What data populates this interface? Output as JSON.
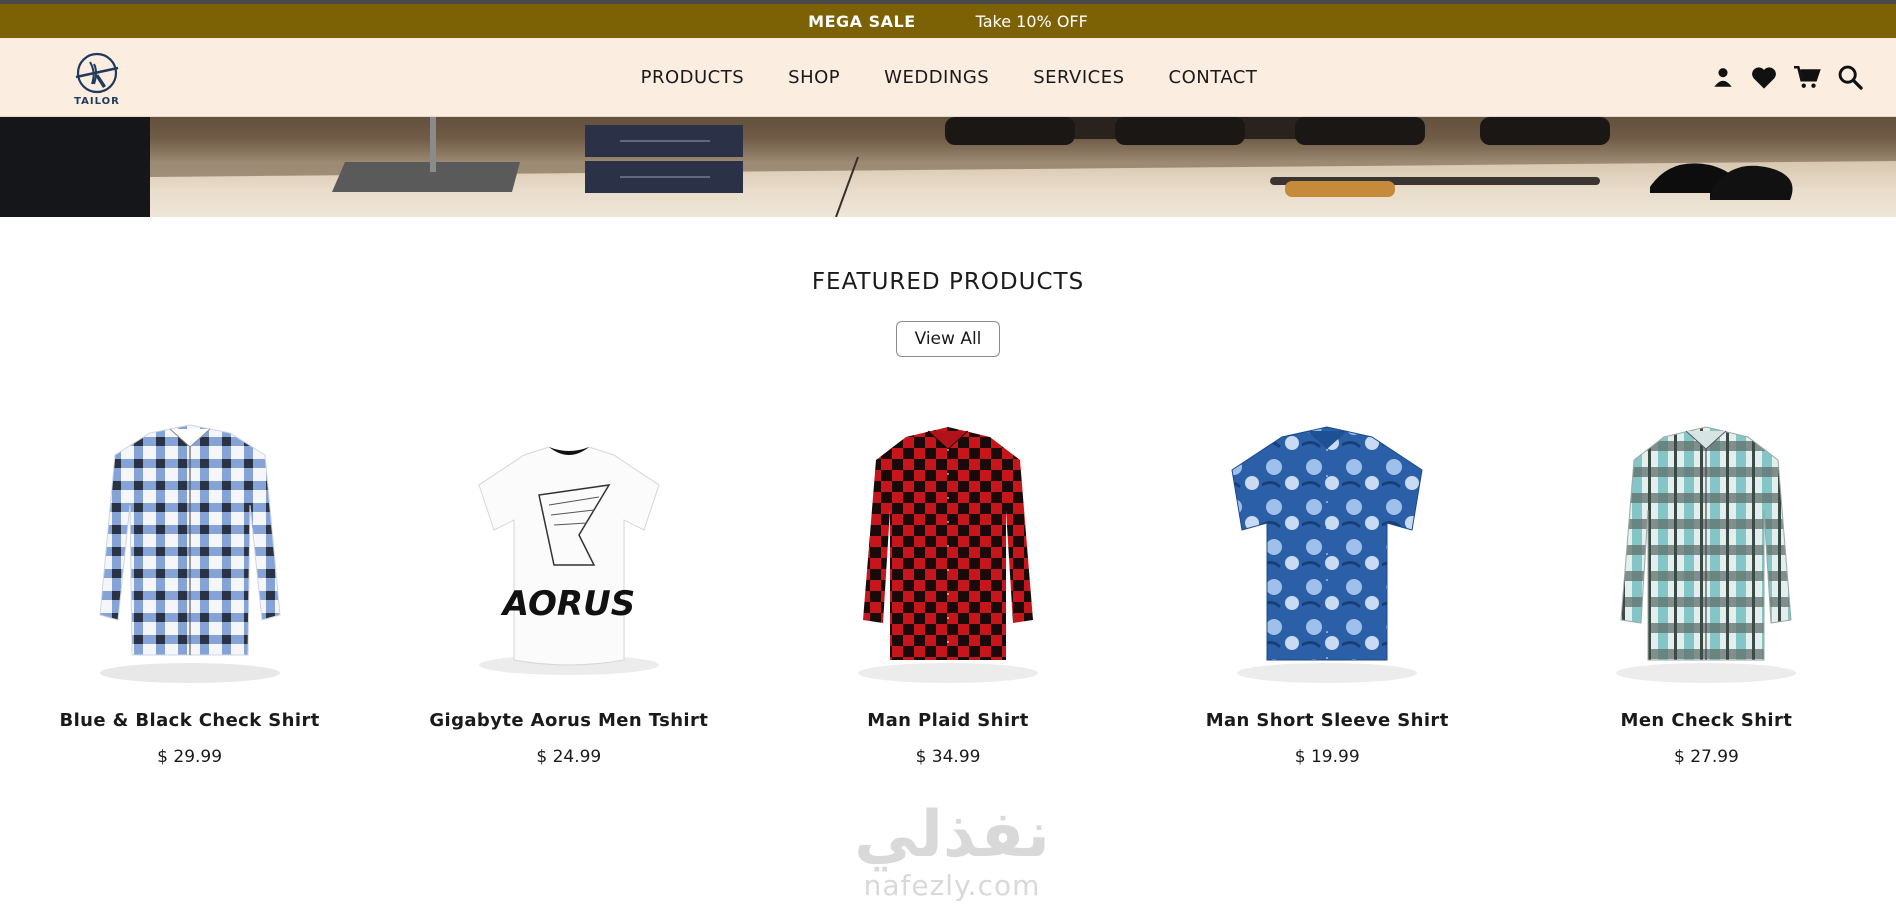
{
  "promo": {
    "sale_label": "MEGA SALE",
    "offer_label": "Take 10% OFF"
  },
  "brand": {
    "logo_text": "TAILOR"
  },
  "nav": {
    "links": [
      {
        "label": "PRODUCTS"
      },
      {
        "label": "SHOP"
      },
      {
        "label": "WEDDINGS"
      },
      {
        "label": "SERVICES"
      },
      {
        "label": "CONTACT"
      }
    ],
    "icons": [
      "user-icon",
      "heart-icon",
      "cart-icon",
      "search-icon"
    ]
  },
  "featured": {
    "title": "FEATURED PRODUCTS",
    "view_all_label": "View All"
  },
  "products": [
    {
      "name": "Blue & Black Check Shirt",
      "price": "$ 29.99",
      "image": "check-shirt-blue"
    },
    {
      "name": "Gigabyte Aorus Men Tshirt",
      "price": "$ 24.99",
      "image": "tshirt-aorus",
      "print_text": "AORUS"
    },
    {
      "name": "Man Plaid Shirt",
      "price": "$ 34.99",
      "image": "plaid-shirt-red"
    },
    {
      "name": "Man Short Sleeve Shirt",
      "price": "$ 19.99",
      "image": "floral-short-sleeve"
    },
    {
      "name": "Men Check Shirt",
      "price": "$ 27.99",
      "image": "check-shirt-teal"
    }
  ],
  "watermark": {
    "arabic": "نفذلي",
    "latin": "nafezly.com"
  },
  "colors": {
    "promo_bg": "#7c6205",
    "nav_bg": "#fcede1",
    "text": "#1a1a1a"
  }
}
